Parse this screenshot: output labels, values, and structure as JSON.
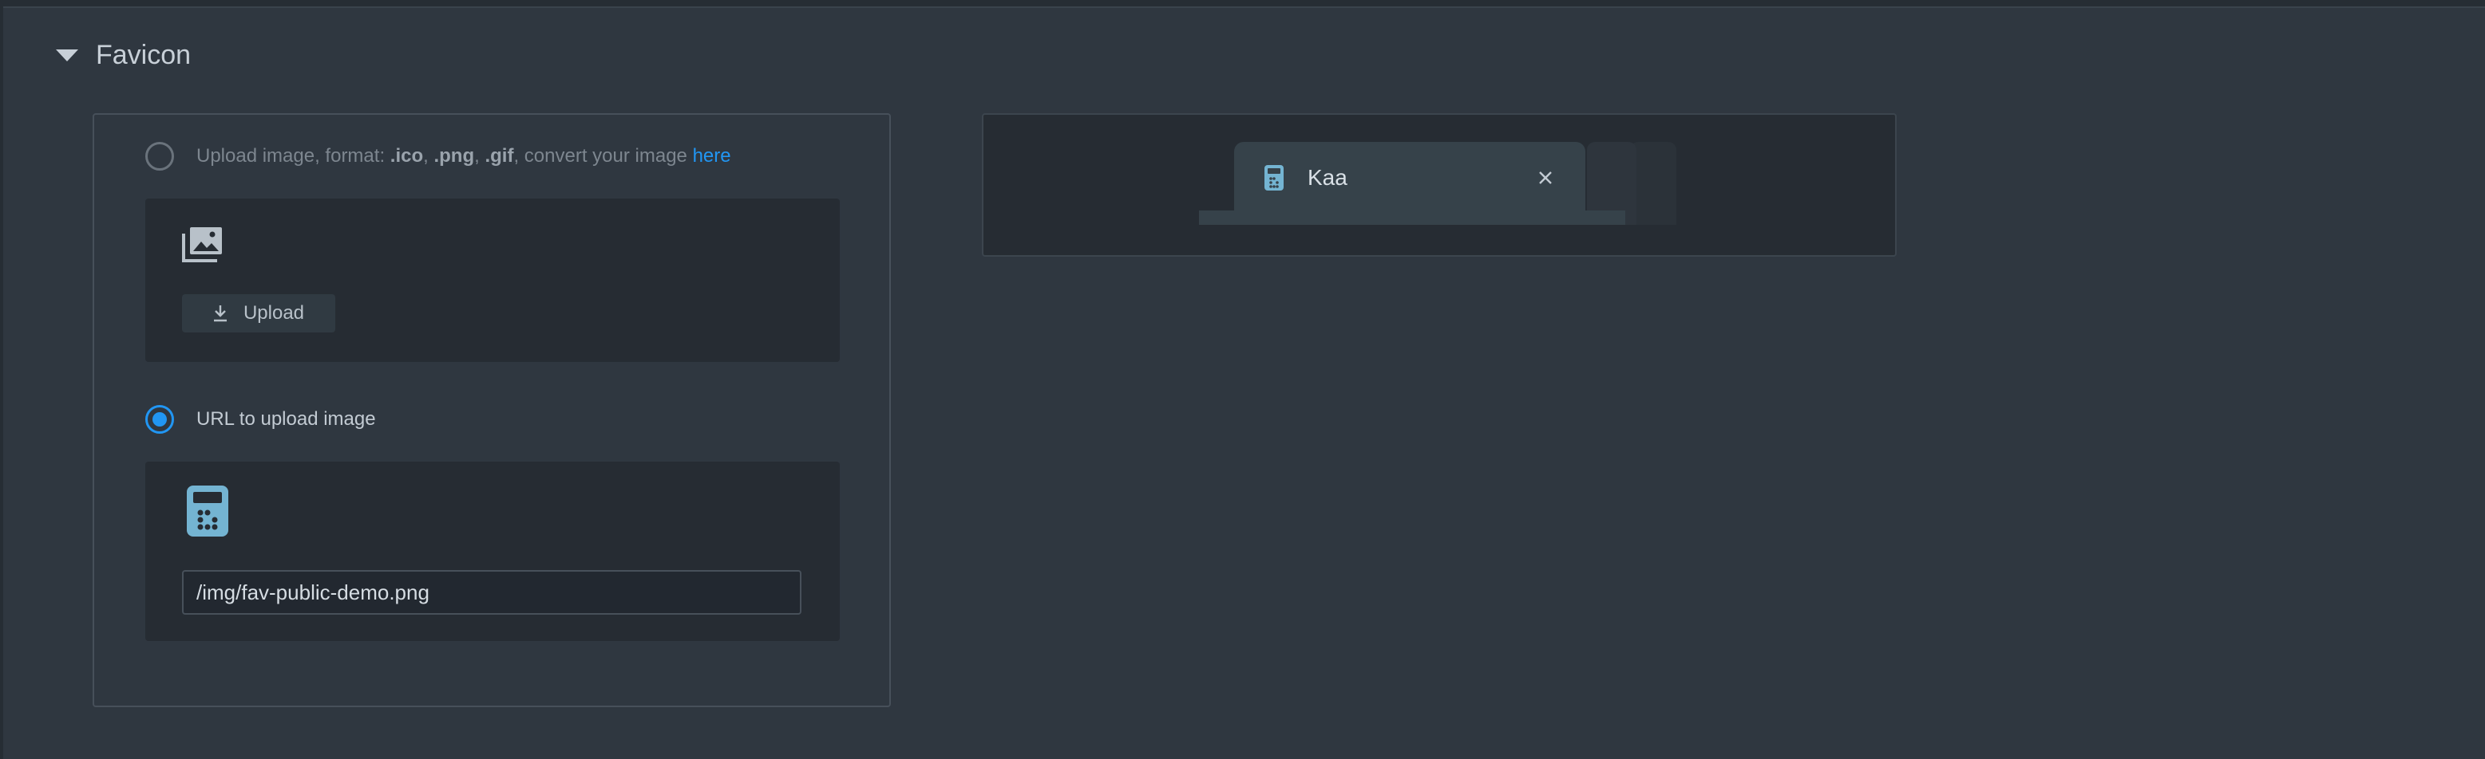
{
  "section": {
    "title": "Favicon"
  },
  "upload_option": {
    "label_prefix": "Upload image, format: ",
    "format_ico": ".ico",
    "sep1": ", ",
    "format_png": ".png",
    "sep2": ", ",
    "format_gif": ".gif",
    "label_suffix": ", convert your image ",
    "link_text": "here",
    "upload_button_label": "Upload",
    "selected": false
  },
  "url_option": {
    "label": "URL to upload image",
    "input_value": "/img/fav-public-demo.png",
    "selected": true
  },
  "preview": {
    "tab_title": "Kaa"
  },
  "icons": {
    "collapse": "caret-down-icon",
    "images": "images-icon",
    "download": "download-icon",
    "favicon": "calculator-icon",
    "close": "close-icon"
  },
  "colors": {
    "accent": "#2196f3",
    "icon_blue": "#74b4d2",
    "background": "#2f3740",
    "panel": "#262c33"
  }
}
